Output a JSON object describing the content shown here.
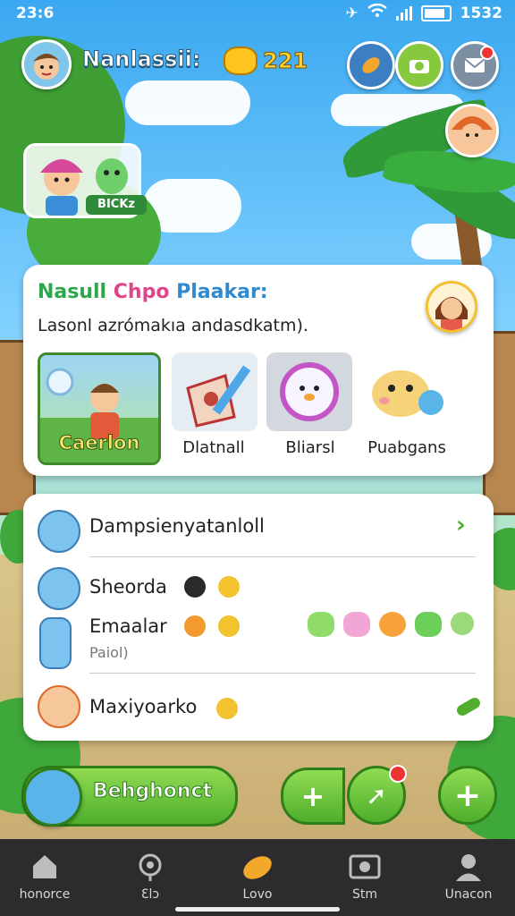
{
  "status_bar": {
    "time": "23:6",
    "battery_text": "1532"
  },
  "header": {
    "player_name": "Nanlassii:",
    "coins": "221"
  },
  "friend_card": {
    "tag": "BICKz"
  },
  "main_card": {
    "title_parts": [
      "Nasull",
      "Chpo",
      "Plaakar:"
    ],
    "subtitle": "Lasonl azrómakıa andasdkatm).",
    "tiles": [
      {
        "label": "Caerlon",
        "icon": "game-art-icon"
      },
      {
        "label": "Dlatnall",
        "icon": "flag-icon"
      },
      {
        "label": "Bliarsl",
        "icon": "pet-icon"
      },
      {
        "label": "Puabgans",
        "icon": "creature-icon"
      }
    ]
  },
  "list_card": {
    "rows": [
      {
        "label": "Dampsienyatanloll",
        "icon": "monster-avatar-icon"
      },
      {
        "label": "Sheorda",
        "icon": "monster-avatar-icon"
      },
      {
        "label": "Emaalar",
        "icon": "robot-figure-icon"
      },
      {
        "label": "Maxiyoarko",
        "icon": "girl-avatar-icon"
      }
    ],
    "emaalar_sub": "Paiol)",
    "creature_icons": [
      "green-monster-icon",
      "pink-monster-icon",
      "sun-monster-icon",
      "green-monster-icon",
      "robot-monster-icon"
    ]
  },
  "actions": {
    "primary_label": "Behghonct",
    "add_icon": "plus-icon",
    "share_icon": "arrow-icon",
    "add_round_icon": "plus-icon"
  },
  "nav": {
    "items": [
      {
        "label": "honorce",
        "icon": "home-icon"
      },
      {
        "label": "Ɛlɔ",
        "icon": "location-icon"
      },
      {
        "label": "Lovo",
        "icon": "leaf-icon"
      },
      {
        "label": "Stm",
        "icon": "camera-icon"
      },
      {
        "label": "Unacon",
        "icon": "profile-icon"
      }
    ]
  },
  "colors": {
    "accent_green": "#4fae2c",
    "title_green": "#2ca84a",
    "title_pink": "#e0458a",
    "title_blue": "#2f8ad0"
  }
}
